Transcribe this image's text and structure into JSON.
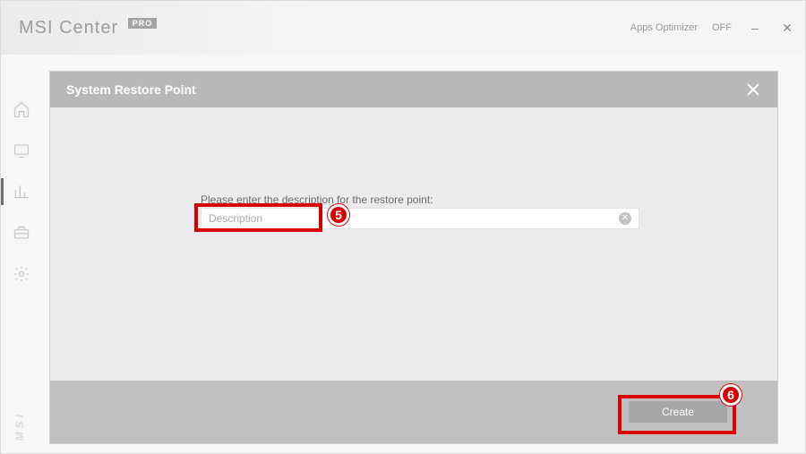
{
  "app": {
    "brand": "MSI Center",
    "brand_badge": "PRO",
    "brand_vertical": "MSI"
  },
  "titlebar": {
    "optimizer_label": "Apps Optimizer",
    "optimizer_state": "OFF"
  },
  "modal": {
    "title": "System Restore Point",
    "prompt": "Please enter the description for the restore point:",
    "placeholder": "Description",
    "value": "",
    "create_label": "Create"
  },
  "callouts": {
    "step5": "5",
    "step6": "6"
  }
}
